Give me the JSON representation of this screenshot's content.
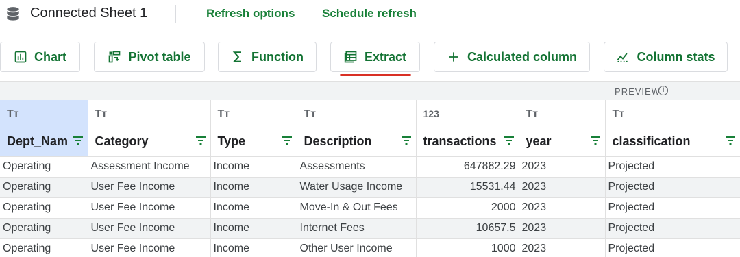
{
  "window": {
    "title": "Connected Sheet 1"
  },
  "header_links": {
    "refresh": "Refresh options",
    "schedule": "Schedule refresh"
  },
  "toolbar": [
    {
      "id": "chart",
      "label": "Chart",
      "icon": "bar-chart-icon"
    },
    {
      "id": "pivot",
      "label": "Pivot table",
      "icon": "pivot-table-icon"
    },
    {
      "id": "function",
      "label": "Function",
      "icon": "sigma-icon"
    },
    {
      "id": "extract",
      "label": "Extract",
      "icon": "extract-table-icon",
      "active": true
    },
    {
      "id": "calc",
      "label": "Calculated column",
      "icon": "plus-icon"
    },
    {
      "id": "stats",
      "label": "Column stats",
      "icon": "column-stats-icon"
    }
  ],
  "preview": {
    "label": "PREVIEW",
    "info_glyph": "i"
  },
  "table": {
    "columns": [
      {
        "type_icon": "Tт",
        "name": "Dept_Nam"
      },
      {
        "type_icon": "Tт",
        "name": "Category"
      },
      {
        "type_icon": "Tт",
        "name": "Type"
      },
      {
        "type_icon": "Tт",
        "name": "Description"
      },
      {
        "type_icon": "123",
        "name": "transactions"
      },
      {
        "type_icon": "Tт",
        "name": "year"
      },
      {
        "type_icon": "Tт",
        "name": "classification"
      }
    ],
    "rows": [
      [
        "Operating",
        "Assessment Income",
        "Income",
        "Assessments",
        "647882.29",
        "2023",
        "Projected"
      ],
      [
        "Operating",
        "User Fee Income",
        "Income",
        "Water Usage Income",
        "15531.44",
        "2023",
        "Projected"
      ],
      [
        "Operating",
        "User Fee Income",
        "Income",
        "Move-In & Out Fees",
        "2000",
        "2023",
        "Projected"
      ],
      [
        "Operating",
        "User Fee Income",
        "Income",
        "Internet Fees",
        "10657.5",
        "2023",
        "Projected"
      ],
      [
        "Operating",
        "User Fee Income",
        "Income",
        "Other User Income",
        "1000",
        "2023",
        "Projected"
      ]
    ]
  },
  "colors": {
    "accent": "#188038",
    "active_underline": "#d93025",
    "selected_header": "#d3e3fd"
  }
}
